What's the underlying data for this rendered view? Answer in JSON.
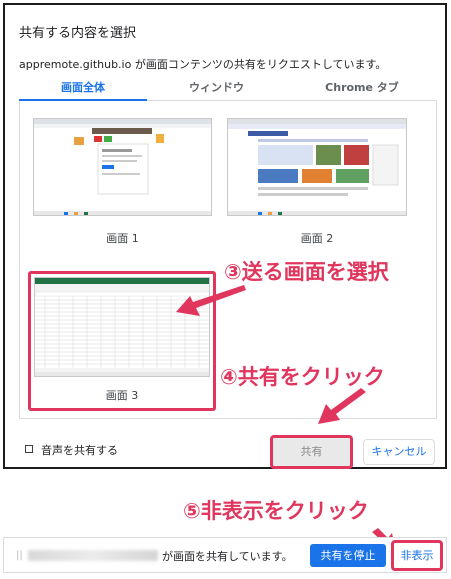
{
  "dialog": {
    "title": "共有する内容を選択",
    "subtitle": "appremote.github.io が画面コンテンツの共有をリクエストしています。",
    "tabs": [
      {
        "label": "画面全体",
        "active": true
      },
      {
        "label": "ウィンドウ",
        "active": false
      },
      {
        "label": "Chrome タブ",
        "active": false
      }
    ],
    "screens": [
      {
        "label": "画面 1"
      },
      {
        "label": "画面 2"
      },
      {
        "label": "画面 3"
      }
    ],
    "audio_label": "音声を共有する",
    "share_label": "共有",
    "cancel_label": "キャンセル"
  },
  "annotations": {
    "step3": "③送る画面を選択",
    "step4": "④共有をクリック",
    "step5": "⑤非表示をクリック"
  },
  "infobar": {
    "message": "が画面を共有しています。",
    "stop_label": "共有を停止",
    "hide_label": "非表示"
  },
  "colors": {
    "accent": "#1a73e8",
    "annotation": "#e0365e",
    "excel_green": "#217346"
  }
}
